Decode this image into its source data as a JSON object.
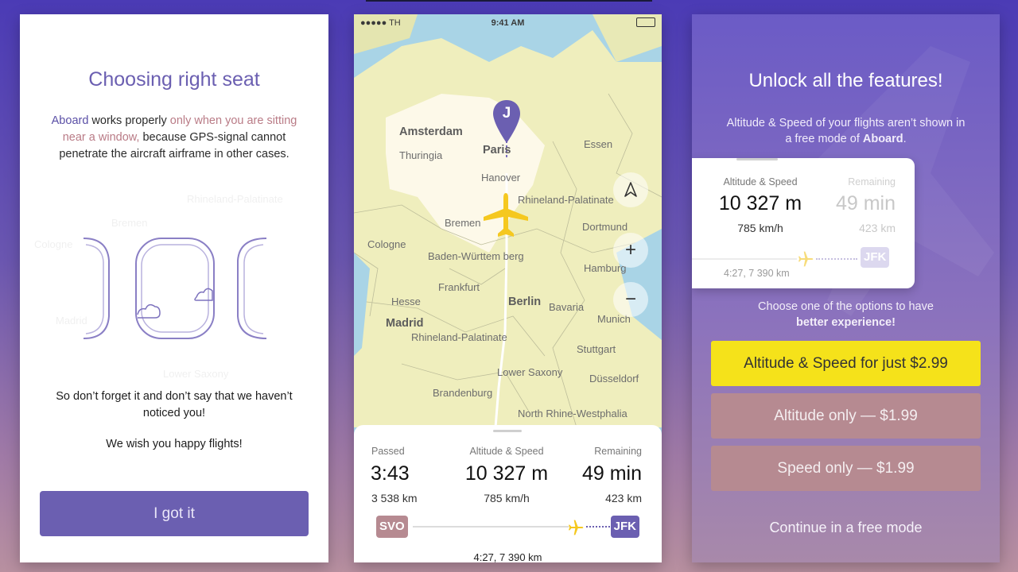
{
  "colors": {
    "background_top": "#4b3bb5",
    "accent_purple": "#6b5fb1",
    "warning_rose": "#b97b86",
    "plane_yellow": "#f5c81f",
    "cta_yellow": "#f5e21a",
    "secondary_rose": "#b68a91",
    "code_svo": "#b68a91",
    "code_jfk": "#6b5fb1"
  },
  "onboarding": {
    "title": "Choosing right seat",
    "intro_brand": "Aboard",
    "intro_part1": " works properly ",
    "intro_warning": "only when you are sitting near a window,",
    "intro_part2": " because GPS-signal cannot penetrate the aircraft airframe in other cases.",
    "reminder": "So don’t forget it and don’t say that we haven’t noticed you!",
    "farewell": "We wish you happy flights!",
    "button_label": "I got it"
  },
  "flight_map": {
    "status": {
      "carrier": "●●●●● TH",
      "time": "9:41 AM"
    },
    "pin_label": "J",
    "map_labels": [
      "Amsterdam",
      "Thuringia",
      "Paris",
      "Essen",
      "Hanover",
      "Rhineland-Palatinate",
      "Bremen",
      "Dortmund",
      "Cologne",
      "Baden-Württem berg",
      "Hamburg",
      "Frankfurt",
      "Berlin",
      "Bavaria",
      "Hesse",
      "Munich",
      "Madrid",
      "Rhineland-Palatinate",
      "Stuttgart",
      "Lower Saxony",
      "Düsseldorf",
      "Brandenburg",
      "North Rhine-Westphalia"
    ],
    "controls": {
      "compass_icon": "compass-arrow-icon",
      "zoom_in": "+",
      "zoom_out": "−"
    },
    "stats": {
      "passed_label": "Passed",
      "passed_time": "3:43",
      "passed_distance": "3 538 km",
      "alt_label": "Altitude & Speed",
      "altitude": "10 327 m",
      "speed": "785 km/h",
      "remaining_label": "Remaining",
      "remaining_time": "49 min",
      "remaining_distance": "423 km"
    },
    "route": {
      "from": "SVO",
      "to": "JFK",
      "summary": "4:27, 7 390 km",
      "progress": 0.85
    }
  },
  "paywall": {
    "title": "Unlock all the features!",
    "subtitle_part1": "Altitude & Speed of your flights aren’t shown in a free mode of ",
    "subtitle_brand": "Aboard",
    "subtitle_end": ".",
    "card": {
      "alt_label": "Altitude & Speed",
      "altitude": "10 327 m",
      "speed": "785 km/h",
      "remaining_label": "Remaining",
      "remaining_time": "49 min",
      "remaining_distance": "423 km",
      "route_to": "JFK",
      "route_summary": "4:27, 7 390 km"
    },
    "choose_part1": "Choose one of the options to have",
    "choose_part2": "better experience!",
    "options": [
      "Altitude & Speed for just $2.99",
      "Altitude only — $1.99",
      "Speed only — $1.99"
    ],
    "continue_label": "Continue in a free mode"
  }
}
